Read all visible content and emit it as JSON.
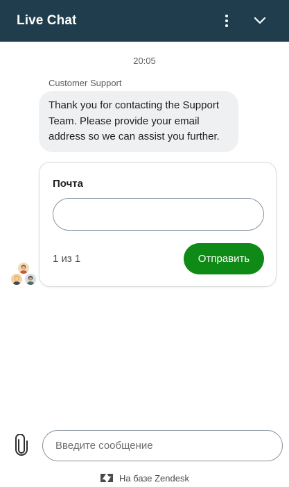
{
  "header": {
    "title": "Live Chat",
    "menu_icon": "more-vertical-icon",
    "collapse_icon": "chevron-down-icon",
    "bg_color": "#1f3d4d"
  },
  "conversation": {
    "timestamp": "20:05",
    "sender": "Customer Support",
    "message": "Thank you for contacting the Support Team. Please provide your email address so we can assist you further."
  },
  "form": {
    "field_label": "Почта",
    "field_value": "",
    "counter": "1 из 1",
    "submit_label": "Отправить",
    "submit_color": "#0f8a16"
  },
  "agents": {
    "avatar_icon": "agent-group-avatar-icon"
  },
  "composer": {
    "placeholder": "Введите сообщение",
    "attach_icon": "paperclip-icon"
  },
  "footer": {
    "label": "На базе Zendesk",
    "logo_icon": "zendesk-logo-icon"
  }
}
